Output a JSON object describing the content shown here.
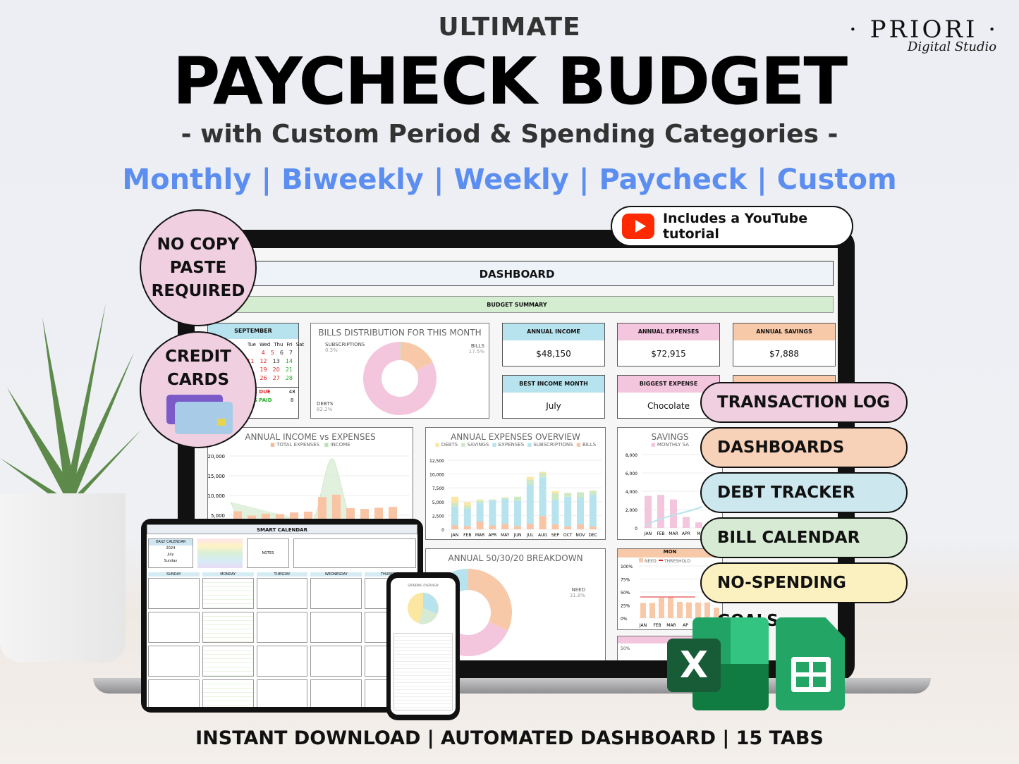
{
  "header": {
    "eyebrow": "ULTIMATE",
    "title": "PAYCHECK BUDGET",
    "subtitle": "- with Custom Period & Spending Categories -",
    "periods": [
      "Monthly",
      "Biweekly",
      "Weekly",
      "Paycheck",
      "Custom"
    ]
  },
  "logo": {
    "brand": "· PRIORI ·",
    "tagline": "Digital Studio"
  },
  "youtube_badge": {
    "icon": "youtube-play-icon",
    "label": "Includes a YouTube tutorial",
    "color": "#ff2a00"
  },
  "badges": [
    {
      "label": "NO COPY PASTE REQUIRED",
      "lines": [
        "NO COPY",
        "PASTE",
        "REQUIRED"
      ]
    },
    {
      "label": "CREDIT CARDS",
      "lines": [
        "CREDIT",
        "CARDS"
      ],
      "icon": "credit-card-icon"
    }
  ],
  "features": [
    {
      "label": "TRANSACTION LOG",
      "color": "#f0cfe0"
    },
    {
      "label": "DASHBOARDS",
      "color": "#f8d2b8"
    },
    {
      "label": "DEBT TRACKER",
      "color": "#cce7ee"
    },
    {
      "label": "BILL CALENDAR",
      "color": "#d6ead4"
    },
    {
      "label": "NO-SPENDING GOALS",
      "color": "#fbf0c0"
    }
  ],
  "dashboard": {
    "title": "DASHBOARD",
    "summary": "BUDGET SUMMARY",
    "calendar": {
      "month": "SEPTEMBER",
      "days": [
        "Tue",
        "Wed",
        "Thu",
        "Fri",
        "Sat"
      ],
      "rows": [
        [
          "4",
          "5",
          "6",
          "7"
        ],
        [
          "11",
          "12",
          "13",
          "14"
        ],
        [
          "19",
          "20",
          "21"
        ],
        [
          "26",
          "27",
          "28"
        ]
      ],
      "due_label": "TS DUE",
      "due": "48",
      "paid_label": "TS PAID",
      "paid": "8"
    },
    "bills_distribution": {
      "title": "BILLS DISTRIBUTION FOR THIS MONTH",
      "slices": [
        {
          "name": "SUBSCRIPTIONS",
          "pct": "0.3%",
          "value": 0.3,
          "color": "#b7e3ef"
        },
        {
          "name": "BILLS",
          "pct": "17.5%",
          "value": 17.5,
          "color": "#f8c9a8"
        },
        {
          "name": "DEBTS",
          "pct": "82.2%",
          "value": 82.2,
          "color": "#f4c6dd"
        }
      ]
    },
    "cards": [
      {
        "label": "ANNUAL INCOME",
        "value": "$48,150",
        "color": "#b7e3ef"
      },
      {
        "label": "ANNUAL EXPENSES",
        "value": "$72,915",
        "color": "#f4c6dd"
      },
      {
        "label": "ANNUAL SAVINGS",
        "value": "$7,888",
        "color": "#f8c9a8"
      },
      {
        "label": "BEST INCOME MONTH",
        "value": "July",
        "color": "#b7e3ef"
      },
      {
        "label": "BIGGEST EXPENSE",
        "value": "Chocolate",
        "color": "#f4c6dd"
      }
    ],
    "income_vs_expenses": {
      "title": "ANNUAL INCOME vs EXPENSES",
      "legend": [
        "TOTAL EXPENSES",
        "INCOME"
      ],
      "y_ticks": [
        "20,000",
        "15,000",
        "10,000",
        "5,000"
      ],
      "expenses": [
        6000,
        4900,
        5400,
        5300,
        5700,
        5900,
        9600,
        10200,
        6800,
        6600,
        6900,
        7100
      ]
    },
    "expenses_overview": {
      "title": "ANNUAL EXPENSES OVERVIEW",
      "legend": [
        "DEBTS",
        "SAVINGS",
        "EXPENSES",
        "SUBSCRIPTIONS",
        "BILLS"
      ],
      "y_ticks": [
        "12,500",
        "10,000",
        "7,500",
        "5,000",
        "2,500",
        "0"
      ],
      "months": [
        "JAN",
        "FEB",
        "MAR",
        "APR",
        "MAY",
        "JUN",
        "JUL",
        "AUG",
        "SEP",
        "OCT",
        "NOV",
        "DEC"
      ],
      "bills": [
        700,
        600,
        1400,
        700,
        1000,
        600,
        1000,
        2400,
        900,
        500,
        900,
        500
      ],
      "expenses": [
        3400,
        3100,
        3400,
        4500,
        4500,
        4600,
        7100,
        7000,
        4400,
        5400,
        4900,
        5800
      ],
      "savings": [
        700,
        600,
        400,
        200,
        200,
        700,
        900,
        800,
        1200,
        700,
        900,
        700
      ],
      "debts": [
        1100,
        600,
        200,
        0,
        100,
        0,
        500,
        200,
        400,
        0,
        0,
        0
      ]
    },
    "savings": {
      "title": "SAVINGS",
      "legend": [
        "MONTHLY SA"
      ],
      "y_ticks": [
        "8,000",
        "6,000",
        "4,000",
        "2,000",
        "0"
      ],
      "months": [
        "JAN",
        "FEB",
        "MAR",
        "APR",
        "M"
      ],
      "values": [
        3500,
        3600,
        3100,
        1200,
        600
      ]
    },
    "breakdown": {
      "title": "ANNUAL 50/30/20 BREAKDOWN",
      "label": "NEED",
      "pct": "31.8%"
    },
    "need_chart": {
      "title": "MON",
      "legend": [
        "NEED",
        "THRESHOLD"
      ],
      "y_ticks": [
        "100%",
        "75%",
        "50%",
        "25%",
        "0%"
      ],
      "months": [
        "JAN",
        "FEB",
        "MAR",
        "AP"
      ],
      "values": [
        29,
        29,
        39,
        40,
        31,
        30,
        30,
        30,
        20,
        25,
        26,
        26
      ],
      "bottom_tick": "50%"
    }
  },
  "tablet": {
    "title": "SMART CALENDAR",
    "year": "2024",
    "month": "July",
    "start_day": "Sunday",
    "notes": "NOTES",
    "weekdays": [
      "SUNDAY",
      "MONDAY",
      "TUESDAY",
      "WEDNESDAY",
      "THURSDAY"
    ]
  },
  "phone": {
    "title": "SPENDING OVERVIEW"
  },
  "apps": [
    {
      "name": "Excel",
      "icon": "excel-icon",
      "color": "#1f7a45"
    },
    {
      "name": "Google Sheets",
      "icon": "google-sheets-icon",
      "color": "#23a566"
    }
  ],
  "footer": "INSTANT DOWNLOAD  |  AUTOMATED DASHBOARD  |  15 TABS"
}
